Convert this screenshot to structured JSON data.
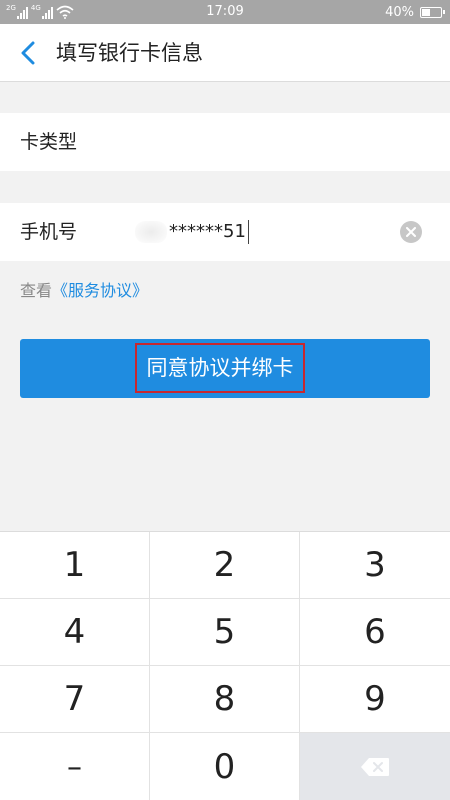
{
  "status_bar": {
    "sim1_tag": "2G",
    "sim2_tag": "4G",
    "time": "17:09",
    "battery_percent": "40%",
    "battery_level": 0.4
  },
  "header": {
    "title": "填写银行卡信息",
    "back_icon": "chevron-left-icon"
  },
  "form": {
    "card_type_label": "卡类型",
    "phone_label": "手机号",
    "phone_value_visible": "******51",
    "clear_icon": "clear-icon"
  },
  "agreement": {
    "prefix": "查看",
    "link_text": "《服务协议》"
  },
  "primary_button": {
    "label": "同意协议并绑卡"
  },
  "keypad": {
    "keys": [
      "1",
      "2",
      "3",
      "4",
      "5",
      "6",
      "7",
      "8",
      "9",
      "–",
      "0"
    ],
    "delete_icon": "backspace-icon"
  },
  "colors": {
    "accent": "#1f8ce0",
    "status_bar": "#a6a6a6",
    "highlight_border": "#c8272f",
    "background": "#f2f2f2"
  }
}
